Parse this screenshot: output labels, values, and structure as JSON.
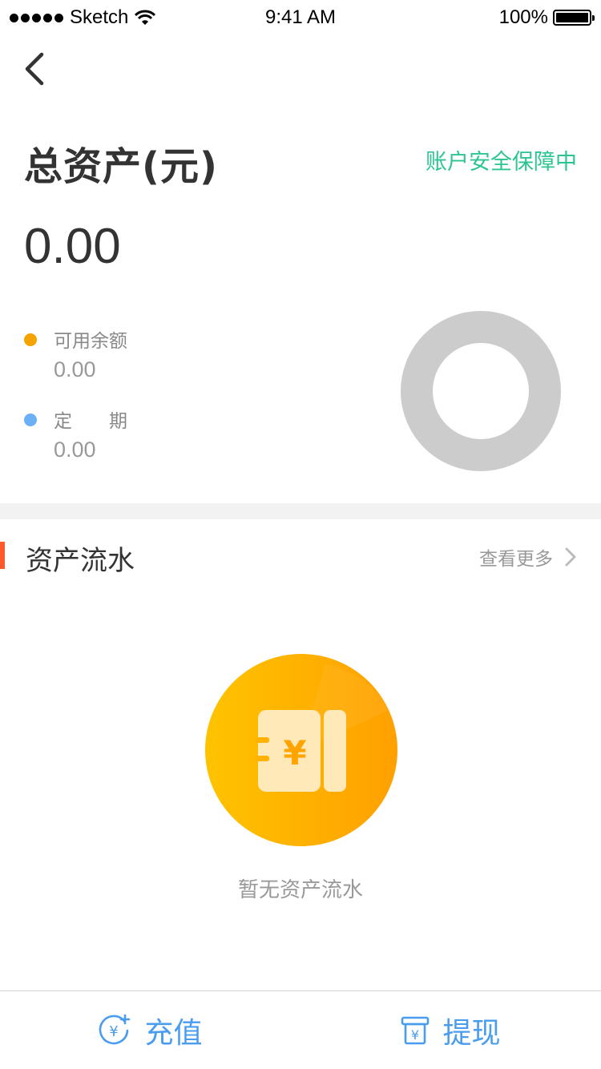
{
  "status_bar": {
    "carrier": "Sketch",
    "time": "9:41 AM",
    "battery": "100%"
  },
  "nav": {
    "back_icon": "chevron-left-icon"
  },
  "header": {
    "title": "总资产(元)",
    "security_text": "账户安全保障中",
    "total_amount": "0.00"
  },
  "breakdown": {
    "items": [
      {
        "label": "可用余额",
        "value": "0.00",
        "color": "#f5a300"
      },
      {
        "label": "定　　期",
        "value": "0.00",
        "color": "#6bb0f4"
      }
    ],
    "donut_color": "#cccccc"
  },
  "flow_section": {
    "title": "资产流水",
    "more_label": "查看更多",
    "accent_color": "#ff5a2c",
    "empty_text": "暂无资产流水",
    "empty_icon": "wallet-yuan-icon"
  },
  "actions": {
    "recharge_label": "充值",
    "withdraw_label": "提现",
    "color": "#4a9cef"
  },
  "colors": {
    "security_green": "#2cc58f"
  }
}
